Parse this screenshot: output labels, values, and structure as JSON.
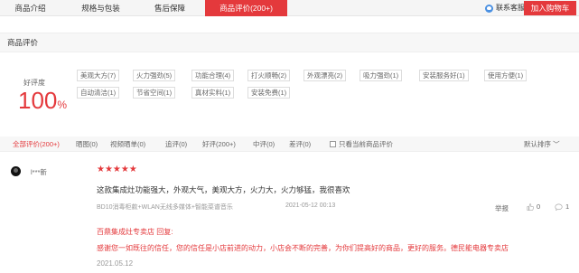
{
  "tabs": [
    {
      "label": "商品介绍",
      "active": false
    },
    {
      "label": "规格与包装",
      "active": false
    },
    {
      "label": "售后保障",
      "active": false
    },
    {
      "label": "商品评价(200+)",
      "active": true
    }
  ],
  "service_label": "联系客服",
  "cart_button": "加入购物车",
  "section_title": "商品评价",
  "rating": {
    "label": "好评度",
    "value": "100",
    "unit": "%"
  },
  "tags": [
    "美观大方(7)",
    "火力强劲(5)",
    "功能合理(4)",
    "打火顺畅(2)",
    "外观漂亮(2)",
    "吸力强劲(1)",
    "安装服务好(1)",
    "使用方便(1)",
    "自动清洁(1)",
    "节省空间(1)",
    "真材实料(1)",
    "安装免费(1)"
  ],
  "filters": [
    "全部评价(200+)",
    "晒图(0)",
    "视频晒单(0)",
    "追评(0)",
    "好评(200+)",
    "中评(0)",
    "差评(0)"
  ],
  "only_current_label": "只看当前商品评价",
  "sort_label": "默认排序",
  "review": {
    "user": "l***新",
    "stars": "★★★★★",
    "text": "这款集成灶功能强大，外观大气，美观大方，火力大，火力够猛，我很喜欢",
    "product": "BD10消毒柜款+WLAN无线多媒体+智能菜谱音乐",
    "time": "2021-05-12 00:13",
    "report_label": "举报",
    "likes": "0",
    "replies": "1",
    "reply_header": "百鼎集成灶专卖店 回复:",
    "reply_text": "感谢您一如既往的信任，您的信任是小店前进的动力，小店会不断的完善，为你们提高好的商品，更好的服务。德民能电器专卖店",
    "reply_date": "2021.05.12"
  },
  "colors": {
    "accent": "#e4393c",
    "muted": "#999999",
    "tag_border": "#dddddd"
  }
}
